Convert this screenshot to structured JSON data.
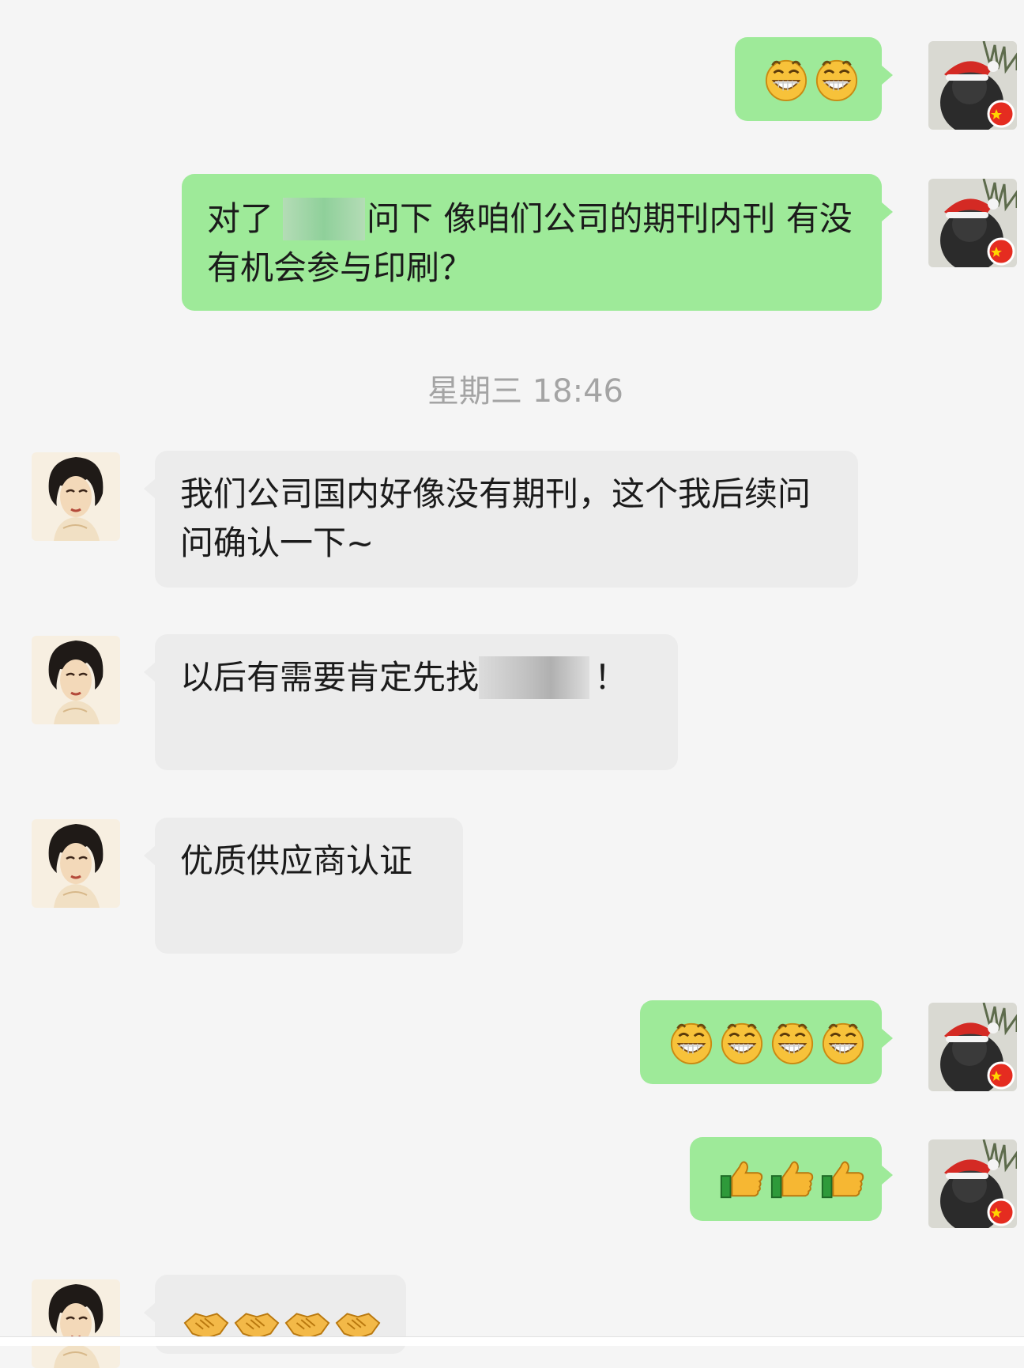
{
  "messages": [
    {
      "id": "m1",
      "side": "self",
      "type": "emoji",
      "emoji": [
        "grin-icon",
        "grin-icon"
      ]
    },
    {
      "id": "m2",
      "side": "self",
      "type": "text",
      "before": "对了",
      "after": "问下 像咱们公司的期刊内刊 有没有机会参与印刷？"
    },
    {
      "id": "m3",
      "side": "other",
      "type": "text",
      "text": "我们公司国内好像没有期刊，这个我后续问问确认一下~"
    },
    {
      "id": "m4",
      "side": "other",
      "type": "text",
      "before": "以后有需要肯定先找",
      "after": "！"
    },
    {
      "id": "m5",
      "side": "other",
      "type": "text",
      "text": "优质供应商认证"
    },
    {
      "id": "m6",
      "side": "self",
      "type": "emoji",
      "emoji": [
        "grin-icon",
        "grin-icon",
        "grin-icon",
        "grin-icon"
      ]
    },
    {
      "id": "m7",
      "side": "self",
      "type": "emoji",
      "emoji": [
        "thumbs-up-icon",
        "thumbs-up-icon",
        "thumbs-up-icon"
      ]
    },
    {
      "id": "m8",
      "side": "other",
      "type": "emoji",
      "emoji": [
        "handshake-icon",
        "handshake-icon",
        "handshake-icon",
        "handshake-icon"
      ]
    }
  ],
  "timestamp": "星期三 18:46",
  "colors": {
    "outgoing": "#9eea99",
    "incoming": "#ececec",
    "background": "#f5f5f5",
    "timestamp": "#a4a4a4"
  }
}
